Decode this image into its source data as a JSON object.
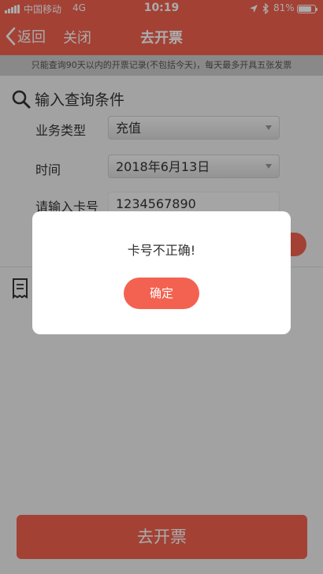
{
  "status_bar": {
    "carrier": "中国移动",
    "network": "4G",
    "time": "10:19",
    "battery_percent": "81%",
    "battery_level": 0.81,
    "icons": [
      "signal-icon",
      "location-icon",
      "bluetooth-icon",
      "battery-icon"
    ]
  },
  "nav": {
    "back_label": "返回",
    "close_label": "关闭",
    "title": "去开票"
  },
  "notice": "只能查询90天以内的开票记录(不包括今天)，每天最多开具五张发票",
  "query": {
    "section_title": "输入查询条件",
    "business_type_label": "业务类型",
    "business_type_value": "充值",
    "time_label": "时间",
    "time_value": "2018年6月13日",
    "card_label": "请输入卡号",
    "card_value": "1234567890"
  },
  "footer": {
    "issue_button": "去开票"
  },
  "dialog": {
    "message": "卡号不正确!",
    "confirm_label": "确定"
  },
  "colors": {
    "accent": "#f36250",
    "overlay": "rgba(0,0,0,0.33)",
    "notice_bg": "#cccccc"
  }
}
